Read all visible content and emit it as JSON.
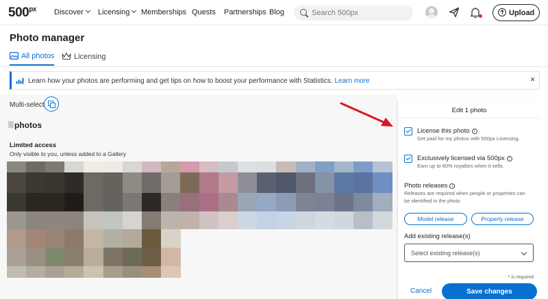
{
  "nav": {
    "logo": "500",
    "logo_sup": "px",
    "items": [
      {
        "label": "Discover",
        "dropdown": true
      },
      {
        "label": "Licensing",
        "dropdown": true
      },
      {
        "label": "Memberships",
        "dropdown": false
      },
      {
        "label": "Quests",
        "dropdown": false
      },
      {
        "label": "Partnerships",
        "dropdown": false
      },
      {
        "label": "Blog",
        "dropdown": false
      }
    ],
    "search_placeholder": "Search 500px",
    "upload_label": "Upload",
    "notification_dot_color": "#e0245e"
  },
  "page": {
    "title": "Photo manager",
    "tabs": [
      {
        "label": "All photos",
        "active": true,
        "icon": "image-icon"
      },
      {
        "label": "Licensing",
        "active": false,
        "icon": "crown-icon"
      }
    ]
  },
  "banner": {
    "text": "Learn how your photos are performing and get tips on how to boost your performance with Statistics.",
    "link": "Learn more",
    "close": "×"
  },
  "gallery": {
    "multiselect_label": "Multi-select",
    "heading": "photos",
    "section_title": "Limited access",
    "section_subtitle": "Only visible to you, unless added to a Gallery"
  },
  "panel": {
    "title": "Edit 1 photo",
    "license": {
      "label": "License this photo",
      "sub": "Get paid for my photos with 500px Licensing.",
      "checked": true
    },
    "exclusive": {
      "label": "Exclusively licensed via 500px",
      "sub": "Earn up to 60% royalties when it sells.",
      "checked": true
    },
    "releases": {
      "title": "Photo releases",
      "desc_line1": "Releases are required when people or properties can",
      "desc_line2": "be identified in the photo",
      "model_button": "Model release",
      "property_button": "Property release"
    },
    "existing": {
      "label": "Add existing release(s)",
      "placeholder": "Select existing release(s)"
    },
    "required_note": "* is required",
    "cancel": "Cancel",
    "save": "Save changes"
  },
  "colors": {
    "accent": "#0870d1",
    "annotation_arrow": "#e0141e"
  }
}
